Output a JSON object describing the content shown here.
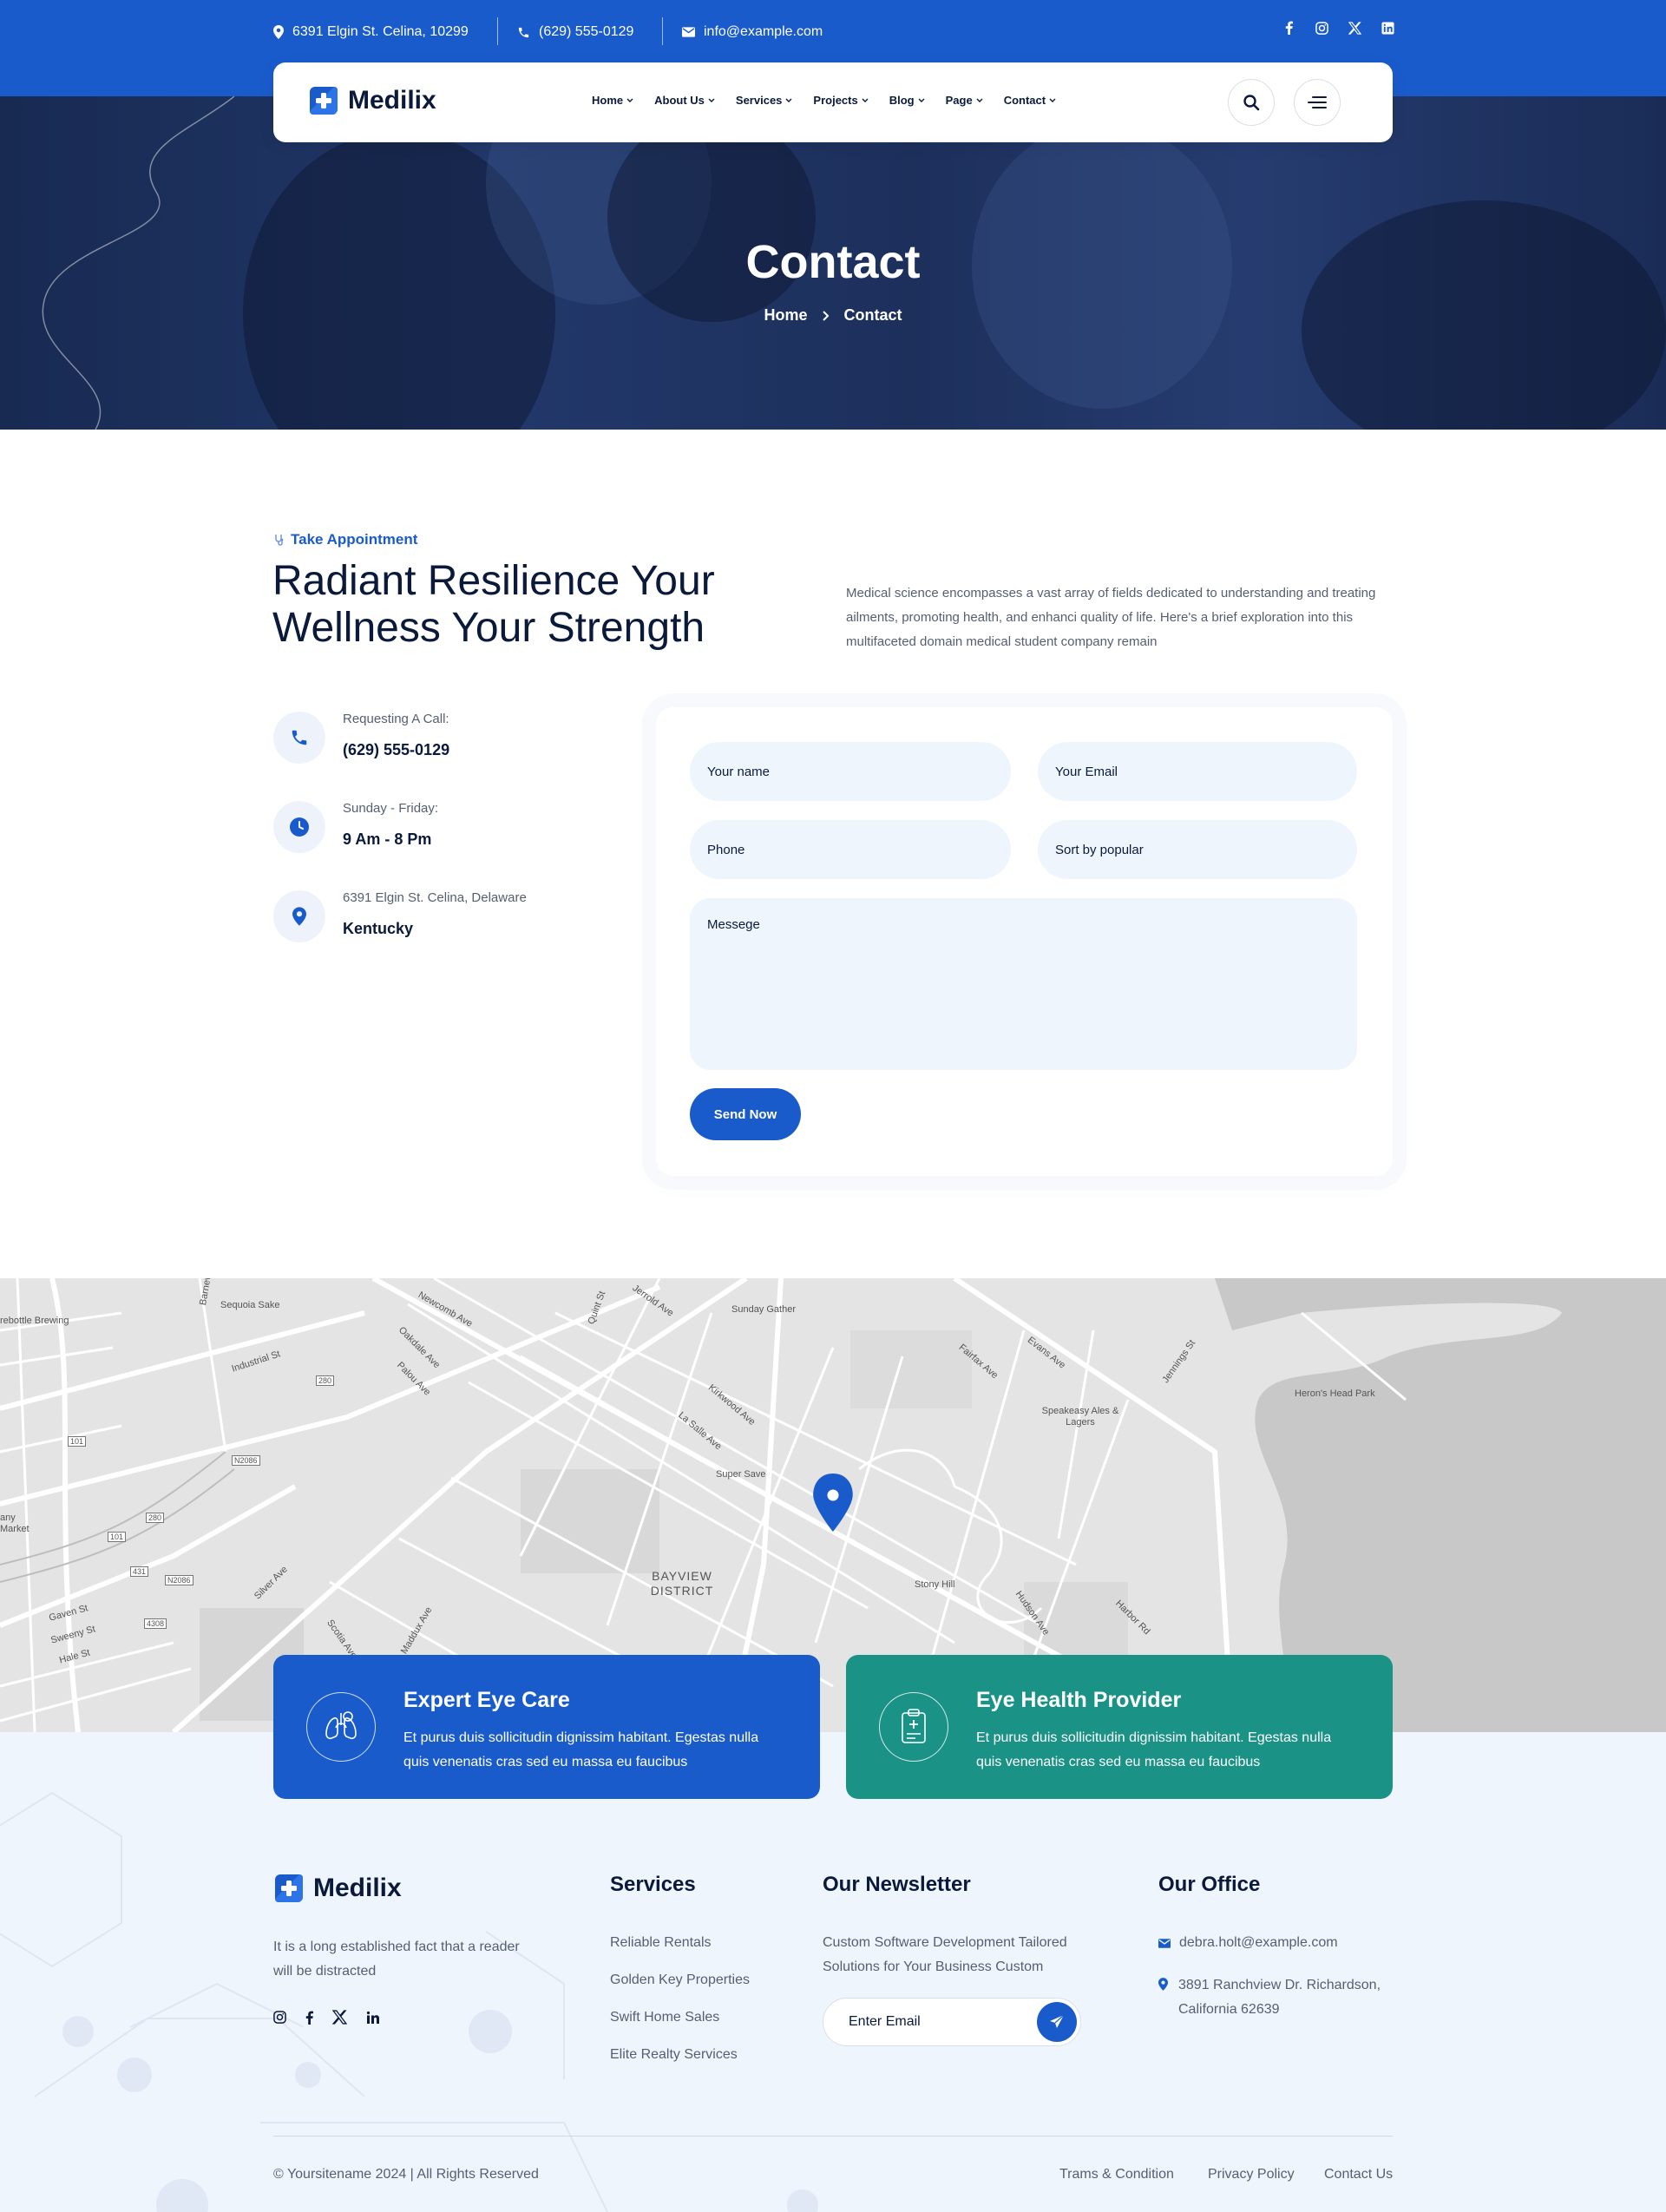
{
  "topbar": {
    "address": "6391 Elgin St. Celina, 10299",
    "phone": "(629) 555-0129",
    "email": "info@example.com",
    "socials": [
      "facebook-icon",
      "instagram-icon",
      "x-icon",
      "linkedin-icon"
    ]
  },
  "brand": {
    "name": "Medilix",
    "accent": "#1a5bcc",
    "teal": "#1a9286"
  },
  "nav": {
    "items": [
      {
        "label": "Home"
      },
      {
        "label": "About Us"
      },
      {
        "label": "Services"
      },
      {
        "label": "Projects"
      },
      {
        "label": "Blog"
      },
      {
        "label": "Page"
      },
      {
        "label": "Contact"
      }
    ]
  },
  "hero": {
    "title": "Contact",
    "breadcrumb": {
      "home": "Home",
      "current": "Contact"
    }
  },
  "appointment": {
    "tag": "Take Appointment",
    "heading": "Radiant Resilience Your Wellness Your Strength",
    "lead": "Medical science encompasses a vast array of fields dedicated to understanding and treating ailments, promoting health, and enhanci quality of life. Here's a brief exploration into this multifaceted domain medical student company remain",
    "contacts": [
      {
        "label": "Requesting A Call:",
        "value": "(629) 555-0129",
        "icon": "phone-icon"
      },
      {
        "label": "Sunday - Friday:",
        "value": "9 Am - 8 Pm",
        "icon": "clock-icon"
      },
      {
        "label": "6391 Elgin St. Celina, Delaware",
        "value": "Kentucky",
        "icon": "location-pin-icon"
      }
    ]
  },
  "form": {
    "name": "Your name",
    "email": "Your Email",
    "phone": "Phone",
    "sort": "Sort by popular",
    "message": "Messege",
    "submit": "Send Now"
  },
  "map": {
    "labels": {
      "sequoia": "Sequoia Sake",
      "brewing": "rebottle Brewing",
      "burnevel": "Barneveld",
      "industrial": "Industrial St",
      "newcomb": "Newcomb Ave",
      "oakdale": "Oakdale Ave",
      "palou": "Palou Ave",
      "quint": "Quint St",
      "jerrold": "Jerrold Ave",
      "sunday": "Sunday Gather",
      "fairfax": "Fairfax Ave",
      "evans": "Evans Ave",
      "jennings": "Jennings St",
      "herons": "Heron's Head Park",
      "speakeasy": "Speakeasy Ales & Lagers",
      "kirkwood": "Kirkwood Ave",
      "lasalle": "La Salle Ave",
      "supersave": "Super Save",
      "bayview": "BAYVIEW DISTRICT",
      "stony": "Stony Hill",
      "hudson": "Hudson Ave",
      "harbor": "Harbor Rd",
      "silver": "Silver Ave",
      "scotia": "Scotia Ave",
      "maddux": "Maddux Ave",
      "gaven": "Gaven St",
      "sweeny": "Sweeny St",
      "hale": "Hale St",
      "market": "any Market",
      "r101a": "101",
      "r101b": "101",
      "r280": "280",
      "r280b": "280",
      "n2086a": "N2086",
      "n2086b": "N2086",
      "r431": "431",
      "r4308": "4308"
    }
  },
  "features": [
    {
      "title": "Expert Eye Care",
      "desc": "Et purus duis sollicitudin dignissim habitant. Egestas nulla quis venenatis cras sed eu massa eu faucibus",
      "icon": "lungs-icon"
    },
    {
      "title": "Eye Health Provider",
      "desc": "Et purus duis sollicitudin dignissim habitant. Egestas nulla quis venenatis cras sed eu massa eu faucibus",
      "icon": "clipboard-medical-icon"
    }
  ],
  "footer": {
    "about": "It is a long established fact that a reader will be distracted",
    "services_title": "Services",
    "services": [
      "Reliable Rentals",
      "Golden Key Properties",
      "Swift Home Sales",
      "Elite Realty Services"
    ],
    "newsletter_title": "Our Newsletter",
    "newsletter_text": "Custom Software Development Tailored Solutions for Your Business Custom",
    "newsletter_placeholder": "Enter Email",
    "office_title": "Our Office",
    "office_email": "debra.holt@example.com",
    "office_address": "3891 Ranchview Dr. Richardson, California 62639",
    "copyright": "© Yoursitename  2024 | All Rights Reserved",
    "links": [
      "Trams & Condition",
      "Privacy Policy",
      "Contact Us"
    ]
  }
}
